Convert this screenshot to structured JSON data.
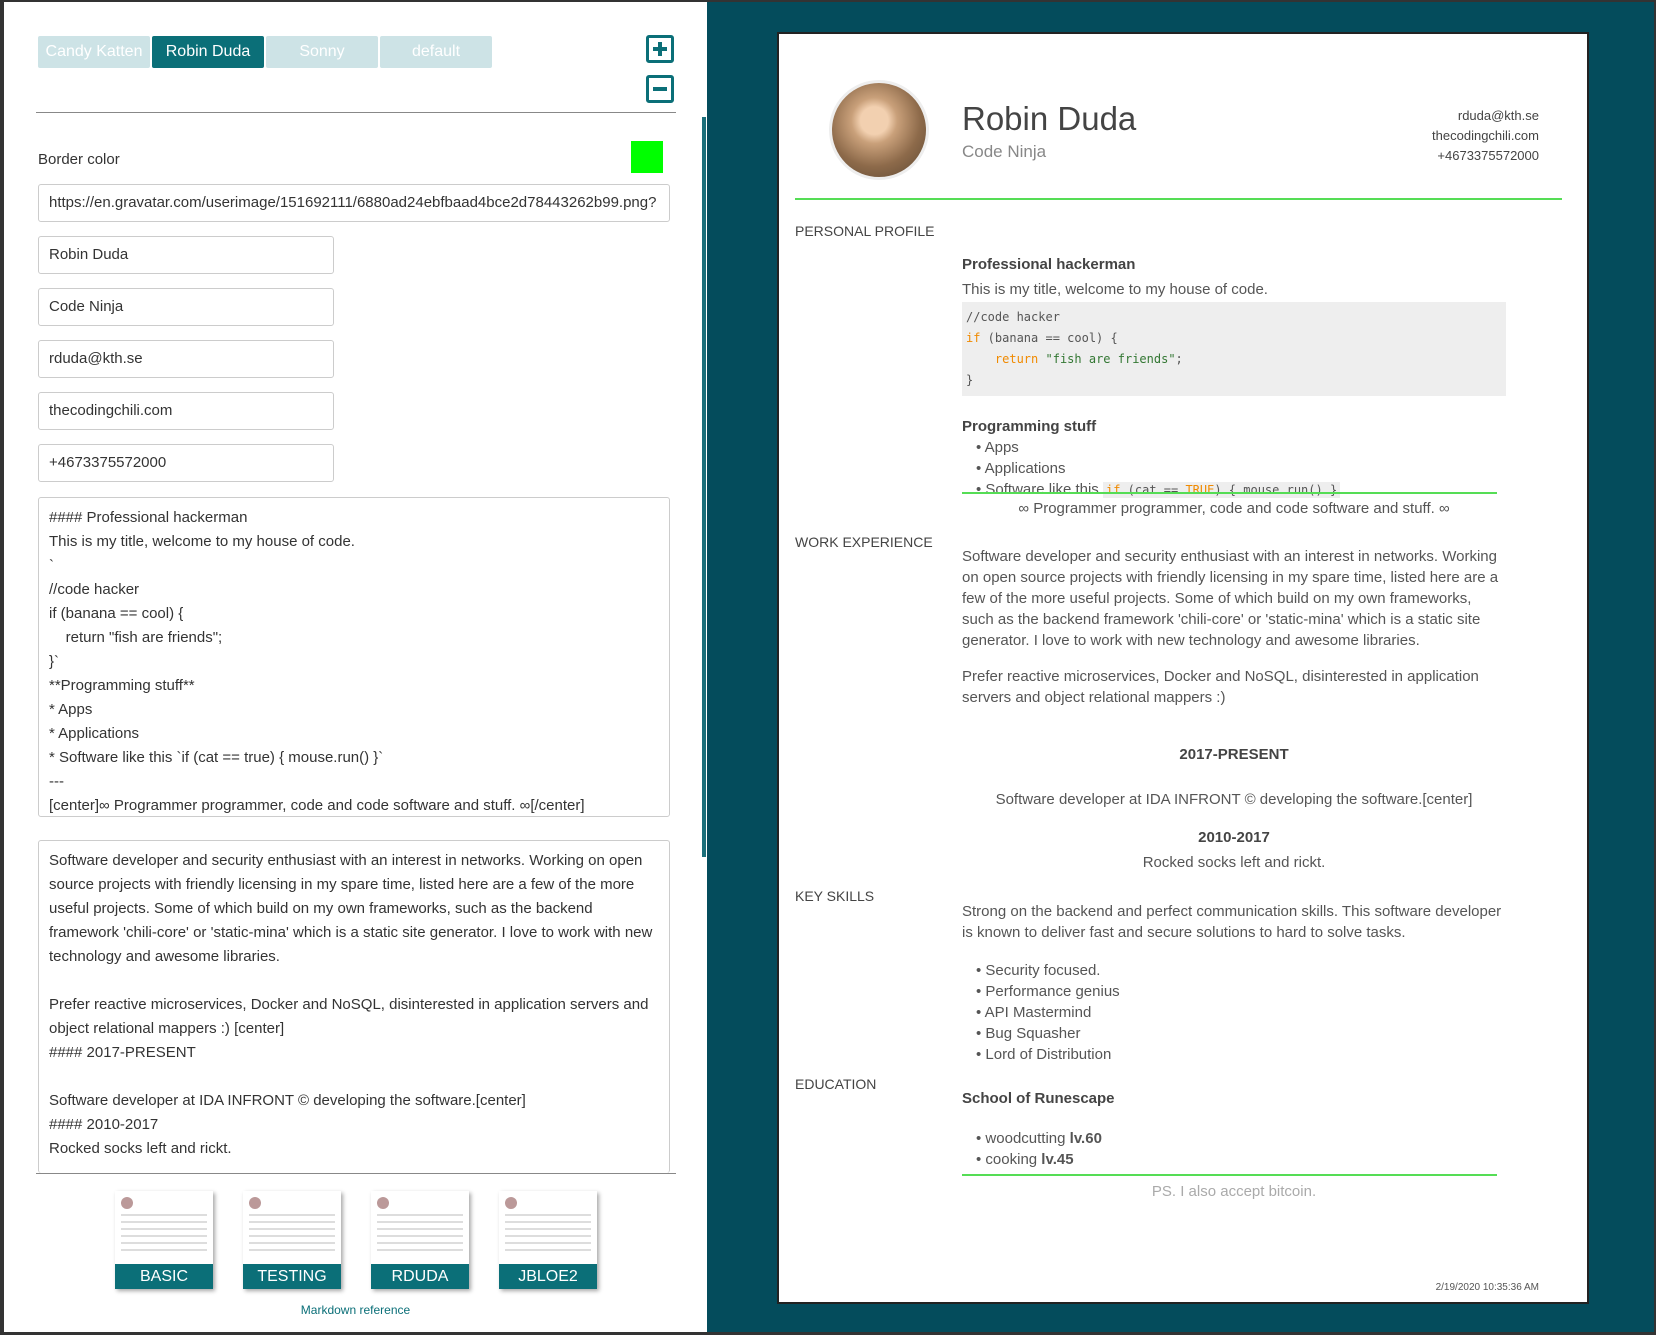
{
  "tabs": [
    "Candy Katten",
    "Robin Duda",
    "Sonny",
    "default"
  ],
  "active_tab": "Robin Duda",
  "border_color_label": "Border color",
  "border_color": "#00ff00",
  "fields": {
    "avatar_url": "https://en.gravatar.com/userimage/151692111/6880ad24ebfbaad4bce2d78443262b99.png?",
    "name": "Robin Duda",
    "title": "Code Ninja",
    "email": "rduda@kth.se",
    "website": "thecodingchili.com",
    "phone": "+4673375572000"
  },
  "profile_markdown": "#### Professional hackerman\nThis is my title, welcome to my house of code.\n`\n//code hacker\nif (banana == cool) {\n    return \"fish are friends\";\n}`\n**Programming stuff**\n* Apps\n* Applications\n* Software like this `if (cat == true) { mouse.run() }`\n---\n[center]∞ Programmer programmer, code and code software and stuff. ∞[/center]",
  "experience_markdown": "Software developer and security enthusiast with an interest in networks. Working on open source projects with friendly licensing in my spare time, listed here are a few of the more useful projects. Some of which build on my own frameworks, such as the backend framework 'chili-core' or 'static-mina' which is a static site generator. I love to work with new technology and awesome libraries.\n\nPrefer reactive microservices, Docker and NoSQL, disinterested in application servers and object relational mappers :) [center]\n#### 2017-PRESENT\n\nSoftware developer at IDA INFRONT © developing the software.[center]\n#### 2010-2017\nRocked socks left and rickt.",
  "templates": [
    "BASIC",
    "TESTING",
    "RDUDA",
    "JBLOE2"
  ],
  "markdown_reference": "Markdown reference",
  "preview": {
    "name": "Robin Duda",
    "title": "Code Ninja",
    "email": "rduda@kth.se",
    "website": "thecodingchili.com",
    "phone": "+4673375572000",
    "sections": {
      "profile": "PERSONAL PROFILE",
      "work": "WORK EXPERIENCE",
      "skills": "KEY SKILLS",
      "education": "EDUCATION"
    },
    "profile_heading": "Professional hackerman",
    "profile_text": "This is my title, welcome to my house of code.",
    "code_comment": "//code hacker",
    "code_if": "if",
    "code_cond": " (banana == cool) {",
    "code_return": "return",
    "code_str": "\"fish are friends\"",
    "code_semi": ";",
    "code_close": "}",
    "prog_heading": "Programming stuff",
    "prog_items": [
      "Apps",
      "Applications"
    ],
    "prog_item3_prefix": "Software like this ",
    "inline_if": "if",
    "inline_mid": " (cat == ",
    "inline_true": "TRUE",
    "inline_end": ") { mouse.run() }",
    "centered_line": "∞ Programmer programmer, code and code software and stuff. ∞",
    "work_p1": "Software developer and security enthusiast with an interest in networks. Working on open source projects with friendly licensing in my spare time, listed here are a few of the more useful projects. Some of which build on my own frameworks, such as the backend framework 'chili-core' or 'static-mina' which is a static site generator. I love to work with new technology and awesome libraries.",
    "work_p2": "Prefer reactive microservices, Docker and NoSQL, disinterested in application servers and object relational mappers :)",
    "period1": "2017-PRESENT",
    "period1_text": "Software developer at IDA INFRONT © developing the software.[center]",
    "period2": "2010-2017",
    "period2_text": "Rocked socks left and rickt.",
    "skills_text": "Strong on the backend and perfect communication skills. This software developer is known to deliver fast and secure solutions to hard to solve tasks.",
    "skills": [
      "Security focused.",
      "Performance genius",
      "API Mastermind",
      "Bug Squasher",
      "Lord of Distribution"
    ],
    "edu_heading": "School of Runescape",
    "edu_items": [
      {
        "label": "woodcutting ",
        "level": "lv.60"
      },
      {
        "label": "cooking ",
        "level": "lv.45"
      }
    ],
    "ps": "PS. I also accept bitcoin.",
    "timestamp": "2/19/2020 10:35:36 AM"
  }
}
